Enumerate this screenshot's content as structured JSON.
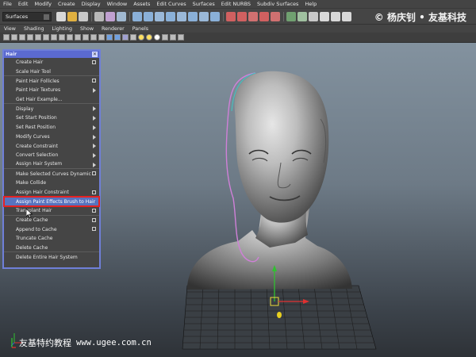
{
  "menubar": {
    "items": [
      "File",
      "Edit",
      "Modify",
      "Create",
      "Display",
      "Window",
      "Assets",
      "Edit Curves",
      "Surfaces",
      "Edit NURBS",
      "Subdiv Surfaces",
      "Help"
    ]
  },
  "shelf": {
    "mode_value": "Surfaces"
  },
  "watermark_top": "© 杨庆钊 • 友基科技",
  "panel_menu": {
    "items": [
      "View",
      "Shading",
      "Lighting",
      "Show",
      "Renderer",
      "Panels"
    ]
  },
  "hair_menu": {
    "title": "Hair",
    "items": [
      {
        "label": "Create Hair",
        "marker": "box"
      },
      {
        "label": "Scale Hair Tool",
        "marker": ""
      },
      {
        "label": "Paint Hair Follicles",
        "marker": "box"
      },
      {
        "label": "Paint Hair Textures",
        "marker": "sub"
      },
      {
        "label": "Get Hair Example...",
        "marker": ""
      },
      {
        "label": "Display",
        "marker": "sub"
      },
      {
        "label": "Set Start Position",
        "marker": "sub"
      },
      {
        "label": "Set Rest Position",
        "marker": "sub"
      },
      {
        "label": "Modify Curves",
        "marker": "sub"
      },
      {
        "label": "Create Constraint",
        "marker": "sub"
      },
      {
        "label": "Convert Selection",
        "marker": "sub"
      },
      {
        "label": "Assign Hair System",
        "marker": "sub"
      },
      {
        "label": "Make Selected Curves Dynamic",
        "marker": "box"
      },
      {
        "label": "Make Collide",
        "marker": ""
      },
      {
        "label": "Assign Hair Constraint",
        "marker": "box"
      },
      {
        "label": "Assign Paint Effects Brush to Hair",
        "marker": ""
      },
      {
        "label": "Transplant Hair",
        "marker": "box"
      },
      {
        "label": "Create Cache",
        "marker": "box"
      },
      {
        "label": "Append to Cache",
        "marker": "box"
      },
      {
        "label": "Truncate Cache",
        "marker": ""
      },
      {
        "label": "Delete Cache",
        "marker": ""
      },
      {
        "label": "Delete Entire Hair System",
        "marker": ""
      }
    ]
  },
  "watermark_bottom": {
    "text": "友基特约教程",
    "url": "www.ugee.com.cn"
  },
  "colors": {
    "viewport_top": "#83929f",
    "menu_highlight": "#5773bf",
    "highlight_border": "#e52222",
    "hair_title_bar": "#5b6ad0"
  }
}
